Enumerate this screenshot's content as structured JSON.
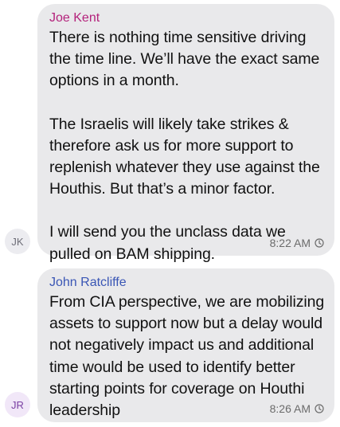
{
  "messages": [
    {
      "sender": "Joe Kent",
      "initials": "JK",
      "time": "8:22 AM",
      "paragraphs": [
        [
          "There is nothing time sensitive driving",
          "the time line. We’ll have the exact same",
          "options in a month."
        ],
        [
          "The Israelis will likely take strikes &",
          "therefore ask us for more support to",
          "replenish whatever they use against the",
          "Houthis. But that’s a minor factor."
        ],
        [
          "I will send you the unclass data we",
          "pulled on BAM shipping."
        ]
      ]
    },
    {
      "sender": "John Ratcliffe",
      "initials": "JR",
      "time": "8:26 AM",
      "paragraphs": [
        [
          "From CIA perspective, we are mobilizing",
          "assets to support now but a delay would",
          "not negatively impact us and additional",
          "time would be used to identify better",
          "starting points for coverage on Houthi",
          "leadership"
        ]
      ]
    }
  ],
  "colors": {
    "bubble": "#e9e9eb",
    "sender_kent": "#b4237c",
    "sender_ratcliffe": "#3a56b5",
    "timestamp": "#6b6b6b"
  },
  "icons": {
    "timestamp_icon": "clock-icon"
  }
}
